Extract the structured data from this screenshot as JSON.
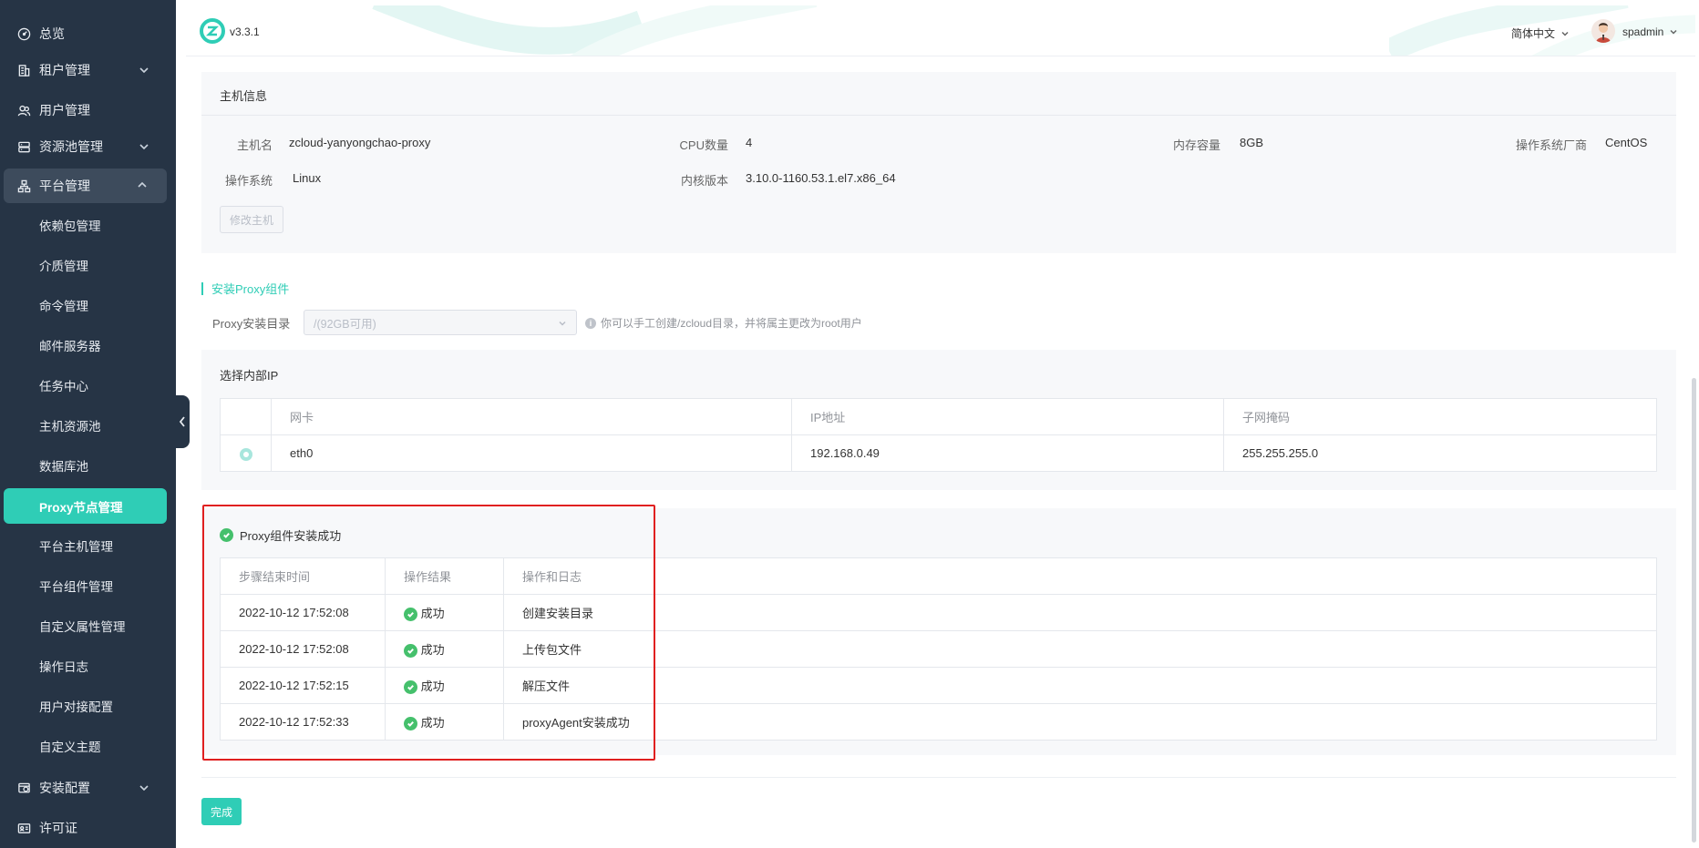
{
  "app": {
    "version": "v3.3.1",
    "language": "简体中文",
    "username": "spadmin",
    "accent_color": "#2fcdb6",
    "sidebar_color": "#263445"
  },
  "sidebar": {
    "items": [
      {
        "label": "总览",
        "icon": "dashboard-icon"
      },
      {
        "label": "租户管理",
        "icon": "building-icon"
      },
      {
        "label": "用户管理",
        "icon": "users-icon"
      },
      {
        "label": "资源池管理",
        "icon": "database-icon"
      },
      {
        "label": "平台管理",
        "icon": "sitemap-icon"
      },
      {
        "label": "安装配置",
        "icon": "install-icon"
      },
      {
        "label": "许可证",
        "icon": "license-icon"
      }
    ],
    "sub_items": [
      "依赖包管理",
      "介质管理",
      "命令管理",
      "邮件服务器",
      "任务中心",
      "主机资源池",
      "数据库池",
      "Proxy节点管理",
      "平台主机管理",
      "平台组件管理",
      "自定义属性管理",
      "操作日志",
      "用户对接配置",
      "自定义主题"
    ],
    "active_sub": "Proxy节点管理"
  },
  "host": {
    "title": "主机信息",
    "fields": {
      "hostname_label": "主机名",
      "hostname": "zcloud-yanyongchao-proxy",
      "cpu_label": "CPU数量",
      "cpu": "4",
      "mem_label": "内存容量",
      "mem": "8GB",
      "vendor_label": "操作系统厂商",
      "vendor": "CentOS",
      "os_label": "操作系统",
      "os": "Linux",
      "kernel_label": "内核版本",
      "kernel": "3.10.0-1160.53.1.el7.x86_64"
    },
    "edit_button": "修改主机"
  },
  "install": {
    "section_title": "安装Proxy组件",
    "dir_label": "Proxy安装目录",
    "dir_value": "/(92GB可用)",
    "hint": "你可以手工创建/zcloud目录，并将属主更改为root用户"
  },
  "ip_table": {
    "title": "选择内部IP",
    "headers": [
      "网卡",
      "IP地址",
      "子网掩码"
    ],
    "rows": [
      {
        "nic": "eth0",
        "ip": "192.168.0.49",
        "mask": "255.255.255.0",
        "selected": true
      }
    ]
  },
  "result": {
    "title": "Proxy组件安装成功",
    "headers": [
      "步骤结束时间",
      "操作结果",
      "操作和日志"
    ],
    "rows": [
      {
        "time": "2022-10-12 17:52:08",
        "status": "成功",
        "action": "创建安装目录"
      },
      {
        "time": "2022-10-12 17:52:08",
        "status": "成功",
        "action": "上传包文件"
      },
      {
        "time": "2022-10-12 17:52:15",
        "status": "成功",
        "action": "解压文件"
      },
      {
        "time": "2022-10-12 17:52:33",
        "status": "成功",
        "action": "proxyAgent安装成功"
      }
    ]
  },
  "footer": {
    "done_button": "完成"
  }
}
